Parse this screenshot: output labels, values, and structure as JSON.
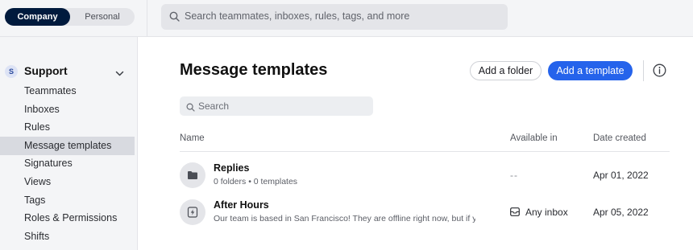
{
  "workspace_toggle": {
    "company": "Company",
    "personal": "Personal"
  },
  "global_search": {
    "placeholder": "Search teammates, inboxes, rules, tags, and more"
  },
  "sidebar": {
    "team": {
      "badge": "S",
      "name": "Support"
    },
    "items": [
      {
        "label": "Teammates",
        "active": false
      },
      {
        "label": "Inboxes",
        "active": false
      },
      {
        "label": "Rules",
        "active": false
      },
      {
        "label": "Message templates",
        "active": true
      },
      {
        "label": "Signatures",
        "active": false
      },
      {
        "label": "Views",
        "active": false
      },
      {
        "label": "Tags",
        "active": false
      },
      {
        "label": "Roles & Permissions",
        "active": false
      },
      {
        "label": "Shifts",
        "active": false
      }
    ]
  },
  "main": {
    "title": "Message templates",
    "add_folder_label": "Add a folder",
    "add_template_label": "Add a template",
    "search_placeholder": "Search",
    "columns": {
      "name": "Name",
      "available_in": "Available in",
      "date_created": "Date created"
    },
    "rows": [
      {
        "icon": "folder-icon",
        "name": "Replies",
        "subtitle": "0 folders • 0 templates",
        "available_in": "--",
        "date_created": "Apr 01, 2022"
      },
      {
        "icon": "lightning-template-icon",
        "name": "After Hours",
        "subtitle": "Our team is based in San Francisco! They are offline right now, but if yc",
        "available_in": "Any inbox",
        "date_created": "Apr 05, 2022"
      }
    ]
  },
  "colors": {
    "accent": "#2563eb",
    "toggle_active": "#001a3d"
  }
}
